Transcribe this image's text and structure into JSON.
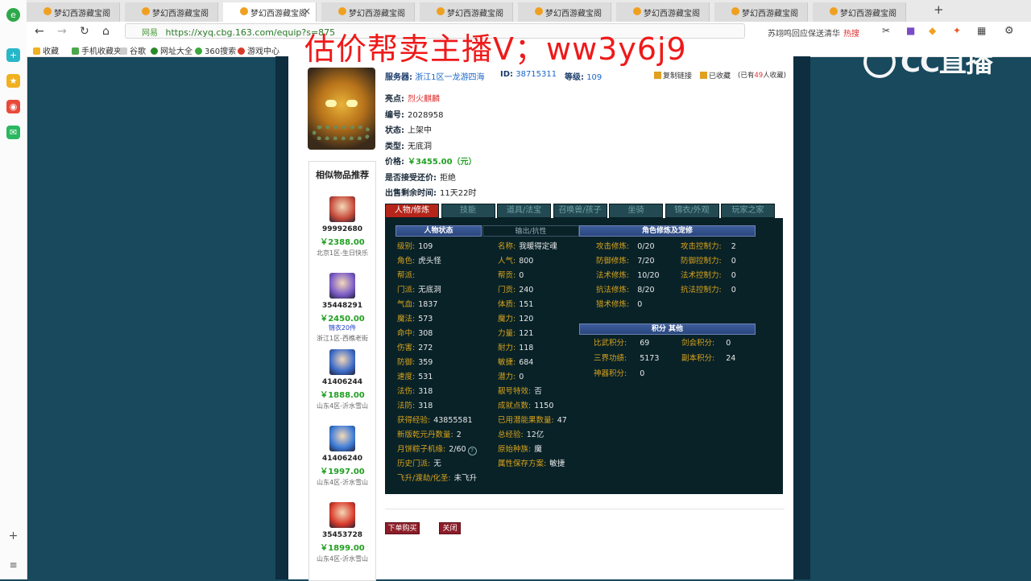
{
  "browser": {
    "tabs": [
      {
        "title": "梦幻西游藏宝阁",
        "active": false
      },
      {
        "title": "梦幻西游藏宝阁",
        "active": false
      },
      {
        "title": "梦幻西游藏宝阁",
        "active": true
      },
      {
        "title": "梦幻西游藏宝阁",
        "active": false
      },
      {
        "title": "梦幻西游藏宝阁",
        "active": false
      },
      {
        "title": "梦幻西游藏宝阁",
        "active": false
      },
      {
        "title": "梦幻西游藏宝阁",
        "active": false
      },
      {
        "title": "梦幻西游藏宝阁",
        "active": false
      },
      {
        "title": "梦幻西游藏宝阁",
        "active": false
      }
    ],
    "close_glyph": "×",
    "new_tab_glyph": "+",
    "address_label": "网易",
    "url": "https://xyq.cbg.163.com/equip?s=875",
    "search_text": "苏翊鸣回应保送清华",
    "search_hot": "热搜",
    "bookmarks": [
      "收藏",
      "手机收藏夹",
      "谷歌",
      "网址大全",
      "360搜索",
      "游戏中心"
    ]
  },
  "overlay_text": "估价帮卖主播V；ww3y6j9",
  "watermark": "CC直播",
  "item": {
    "server_label": "服务器:",
    "server": "浙江1区一龙游四海",
    "id_label": "ID:",
    "id": "38715311",
    "level_label": "等级:",
    "level": "109",
    "copy_link": "复制链接",
    "favorited": "已收藏",
    "fav_count_prefix": "(已有",
    "fav_count": "49",
    "fav_count_suffix": "人收藏)",
    "fields": [
      {
        "k": "亮点:",
        "v": "烈火麒麟",
        "style": "hl"
      },
      {
        "k": "编号:",
        "v": "2028958",
        "style": ""
      },
      {
        "k": "状态:",
        "v": "上架中",
        "style": ""
      },
      {
        "k": "类型:",
        "v": "无底洞",
        "style": ""
      },
      {
        "k": "价格:",
        "v": "￥3455.00（元）",
        "style": "price"
      },
      {
        "k": "是否接受还价:",
        "v": "拒绝",
        "style": ""
      },
      {
        "k": "出售剩余时间:",
        "v": "11天22时",
        "style": ""
      }
    ]
  },
  "similar": {
    "title": "相似物品推荐",
    "items": [
      {
        "id": "99992680",
        "price": "￥2388.00",
        "extra": "",
        "server": "北京1区-生日快乐",
        "color": "#c64a3a"
      },
      {
        "id": "35448291",
        "price": "￥2450.00",
        "extra": "锦衣20件",
        "server": "浙江1区-西樵老街",
        "color": "#7a5ac8"
      },
      {
        "id": "41406244",
        "price": "￥1888.00",
        "extra": "",
        "server": "山东4区-沂水雪山",
        "color": "#3a6ac8"
      },
      {
        "id": "41406240",
        "price": "￥1997.00",
        "extra": "",
        "server": "山东4区-沂水雪山",
        "color": "#3a7ad8"
      },
      {
        "id": "35453728",
        "price": "￥1899.00",
        "extra": "",
        "server": "山东4区-沂水雪山",
        "color": "#d83a2a"
      }
    ]
  },
  "game_tabs": [
    "人物/修炼",
    "技能",
    "道具/法宝",
    "召唤兽/孩子",
    "坐骑",
    "锦衣/外观",
    "玩家之家"
  ],
  "panel": {
    "status_header": "人物状态",
    "attr_header": "输出/抗性",
    "cultivation_header": "角色修炼及宠修",
    "score_header": "积分 其他",
    "col1": [
      {
        "k": "级别:",
        "v": "109"
      },
      {
        "k": "角色:",
        "v": "虎头怪"
      },
      {
        "k": "帮派:",
        "v": ""
      },
      {
        "k": "门派:",
        "v": "无底洞"
      },
      {
        "k": "气血:",
        "v": "1837"
      },
      {
        "k": "魔法:",
        "v": "573"
      },
      {
        "k": "命中:",
        "v": "308"
      },
      {
        "k": "伤害:",
        "v": "272"
      },
      {
        "k": "防御:",
        "v": "359"
      },
      {
        "k": "速度:",
        "v": "531"
      },
      {
        "k": "法伤:",
        "v": "318"
      },
      {
        "k": "法防:",
        "v": "318"
      }
    ],
    "col2": [
      {
        "k": "名称:",
        "v": "我暖得定魂"
      },
      {
        "k": "人气:",
        "v": "800"
      },
      {
        "k": "帮贡:",
        "v": "0"
      },
      {
        "k": "门贡:",
        "v": "240"
      },
      {
        "k": "体质:",
        "v": "151"
      },
      {
        "k": "魔力:",
        "v": "120"
      },
      {
        "k": "力量:",
        "v": "121"
      },
      {
        "k": "耐力:",
        "v": "118"
      },
      {
        "k": "敏捷:",
        "v": "684"
      },
      {
        "k": "潜力:",
        "v": "0"
      },
      {
        "k": "靓号特效:",
        "v": "否"
      },
      {
        "k": "成就点数:",
        "v": "1150"
      }
    ],
    "wide": [
      {
        "k": "获得经验:",
        "v": "43855581",
        "k2": "已用潜能果数量:",
        "v2": "47"
      },
      {
        "k": "新版乾元丹数量:",
        "v": "2",
        "k2": "总经验:",
        "v2": "12亿"
      },
      {
        "k": "月饼粽子机缘:",
        "v": "2/60",
        "k2": "原始种族:",
        "v2": "魔"
      },
      {
        "k": "历史门派:",
        "v": "无",
        "k2": "属性保存方案:",
        "v2": "敏捷"
      },
      {
        "k": "飞升/渡劫/化圣:",
        "v": "未飞升",
        "k2": "",
        "v2": ""
      }
    ],
    "help_glyph": "?",
    "cultivation": [
      {
        "k": "攻击修炼:",
        "v": "0/20",
        "k2": "攻击控制力:",
        "v2": "2"
      },
      {
        "k": "防御修炼:",
        "v": "7/20",
        "k2": "防御控制力:",
        "v2": "0"
      },
      {
        "k": "法术修炼:",
        "v": "10/20",
        "k2": "法术控制力:",
        "v2": "0"
      },
      {
        "k": "抗法修炼:",
        "v": "8/20",
        "k2": "抗法控制力:",
        "v2": "0"
      },
      {
        "k": "猎术修炼:",
        "v": "0",
        "k2": "",
        "v2": ""
      }
    ],
    "scores": [
      {
        "k": "比武积分:",
        "v": "69",
        "k2": "剑会积分:",
        "v2": "0"
      },
      {
        "k": "三界功绩:",
        "v": "5173",
        "k2": "副本积分:",
        "v2": "24"
      },
      {
        "k": "神器积分:",
        "v": "0",
        "k2": "",
        "v2": ""
      }
    ]
  },
  "actions": {
    "buy": "下单购买",
    "close": "关闭"
  }
}
